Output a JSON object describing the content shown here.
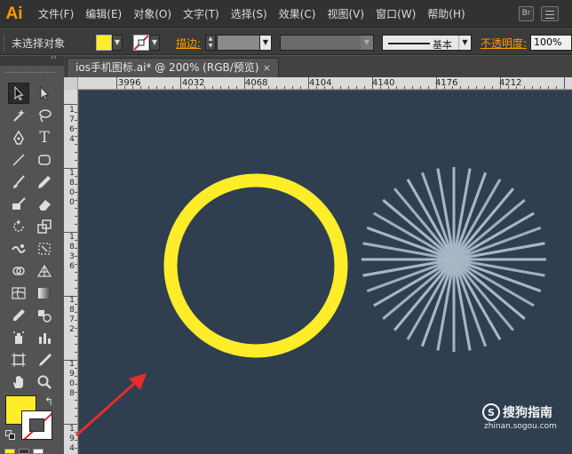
{
  "app": {
    "logo_text": "Ai",
    "menus": [
      "文件(F)",
      "编辑(E)",
      "对象(O)",
      "文字(T)",
      "选择(S)",
      "效果(C)",
      "视图(V)",
      "窗口(W)",
      "帮助(H)"
    ],
    "bridge_label": "Br"
  },
  "control_bar": {
    "selection_status": "未选择对象",
    "fill_color": "#ffed2a",
    "stroke_label": "描边:",
    "brush_profile": "基本",
    "opacity_label": "不透明度:",
    "opacity_value": "100%"
  },
  "document": {
    "tab_title": "ios手机图标.ai* @ 200% (RGB/预览)",
    "close_glyph": "×"
  },
  "rulers": {
    "horizontal": [
      "3996",
      "4032",
      "4068",
      "4104",
      "4140",
      "4176",
      "4212"
    ],
    "vertical": [
      "1764",
      "1800",
      "1836",
      "1872",
      "1908",
      "194"
    ]
  },
  "tools": [
    {
      "name": "selection-tool",
      "icon": "arrow-icon",
      "active": true
    },
    {
      "name": "direct-selection-tool",
      "icon": "white-arrow-icon"
    },
    {
      "name": "magic-wand-tool",
      "icon": "magic-wand-icon"
    },
    {
      "name": "lasso-tool",
      "icon": "lasso-icon"
    },
    {
      "name": "pen-tool",
      "icon": "pen-icon"
    },
    {
      "name": "type-tool",
      "icon": "type-icon",
      "glyph": "T"
    },
    {
      "name": "line-tool",
      "icon": "line-icon"
    },
    {
      "name": "rectangle-tool",
      "icon": "rounded-rect-icon"
    },
    {
      "name": "paintbrush-tool",
      "icon": "brush-icon"
    },
    {
      "name": "pencil-tool",
      "icon": "pencil-icon"
    },
    {
      "name": "blob-brush-tool",
      "icon": "blob-brush-icon"
    },
    {
      "name": "eraser-tool",
      "icon": "eraser-icon"
    },
    {
      "name": "rotate-tool",
      "icon": "rotate-icon"
    },
    {
      "name": "scale-tool",
      "icon": "scale-icon"
    },
    {
      "name": "warp-tool",
      "icon": "warp-icon"
    },
    {
      "name": "free-transform-tool",
      "icon": "free-transform-icon"
    },
    {
      "name": "shape-builder-tool",
      "icon": "shape-builder-icon"
    },
    {
      "name": "perspective-grid-tool",
      "icon": "perspective-grid-icon"
    },
    {
      "name": "mesh-tool",
      "icon": "mesh-icon"
    },
    {
      "name": "gradient-tool",
      "icon": "gradient-icon"
    },
    {
      "name": "eyedropper-tool",
      "icon": "eyedropper-icon"
    },
    {
      "name": "blend-tool",
      "icon": "blend-icon"
    },
    {
      "name": "symbol-sprayer-tool",
      "icon": "symbol-sprayer-icon"
    },
    {
      "name": "column-graph-tool",
      "icon": "column-graph-icon"
    },
    {
      "name": "artboard-tool",
      "icon": "artboard-icon"
    },
    {
      "name": "slice-tool",
      "icon": "slice-icon"
    },
    {
      "name": "hand-tool",
      "icon": "hand-icon"
    },
    {
      "name": "zoom-tool",
      "icon": "zoom-icon"
    }
  ],
  "colors": {
    "canvas_bg": "#2f3f4f",
    "ring": "#ffed2a",
    "burst_lines": "#a9b7c6",
    "annotation_arrow": "#e82c2c",
    "accent_orange": "#ff9a00"
  },
  "watermark": {
    "logo_glyph": "S",
    "title": "搜狗指南",
    "url": "zhinan.sogou.com"
  }
}
